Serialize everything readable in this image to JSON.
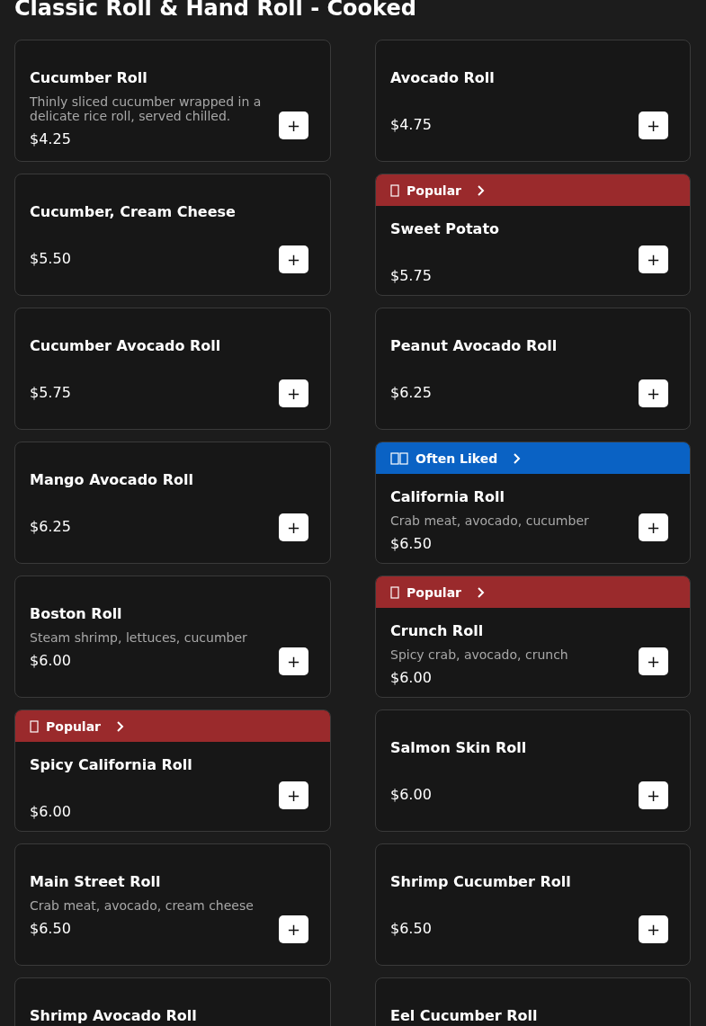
{
  "section_title": "Classic Roll & Hand Roll - Cooked",
  "rows": [
    {
      "cards": [
        {
          "name": "Cucumber Roll",
          "description": "Thinly sliced cucumber wrapped in a delicate rice roll, served chilled.",
          "price": "$4.25",
          "add": "+"
        },
        {
          "name": "Avocado Roll",
          "price": "$4.75",
          "add": "+"
        }
      ]
    },
    {
      "cards": [
        {
          "name": "Cucumber, Cream Cheese",
          "price": "$5.50",
          "add": "+"
        },
        {
          "badge": {
            "kind": "popular",
            "label": "Popular",
            "color": "#9a2a2c"
          },
          "name": "Sweet Potato",
          "price": "$5.75",
          "add": "+"
        }
      ]
    },
    {
      "cards": [
        {
          "name": "Cucumber Avocado Roll",
          "price": "$5.75",
          "add": "+"
        },
        {
          "name": "Peanut Avocado Roll",
          "price": "$6.25",
          "add": "+"
        }
      ]
    },
    {
      "cards": [
        {
          "name": "Mango Avocado Roll",
          "price": "$6.25",
          "add": "+"
        },
        {
          "badge": {
            "kind": "often_liked",
            "label": "Often Liked",
            "color": "#0a62c4"
          },
          "name": "California Roll",
          "description": "Crab meat, avocado, cucumber",
          "price": "$6.50",
          "add": "+"
        }
      ]
    },
    {
      "cards": [
        {
          "name": "Boston Roll",
          "description": "Steam shrimp, lettuces, cucumber",
          "price": "$6.00",
          "add": "+"
        },
        {
          "badge": {
            "kind": "popular",
            "label": "Popular",
            "color": "#9a2a2c"
          },
          "name": "Crunch Roll",
          "description": "Spicy crab, avocado, crunch",
          "price": "$6.00",
          "add": "+"
        }
      ]
    },
    {
      "cards": [
        {
          "badge": {
            "kind": "popular",
            "label": "Popular",
            "color": "#9a2a2c"
          },
          "name": "Spicy California Roll",
          "price": "$6.00",
          "add": "+"
        },
        {
          "name": "Salmon Skin Roll",
          "price": "$6.00",
          "add": "+"
        }
      ]
    },
    {
      "cards": [
        {
          "name": "Main Street Roll",
          "description": "Crab meat, avocado, cream cheese",
          "price": "$6.50",
          "add": "+"
        },
        {
          "name": "Shrimp Cucumber Roll",
          "price": "$6.50",
          "add": "+"
        }
      ]
    },
    {
      "cards": [
        {
          "name": "Shrimp Avocado Roll"
        },
        {
          "name": "Eel Cucumber Roll"
        }
      ]
    }
  ]
}
